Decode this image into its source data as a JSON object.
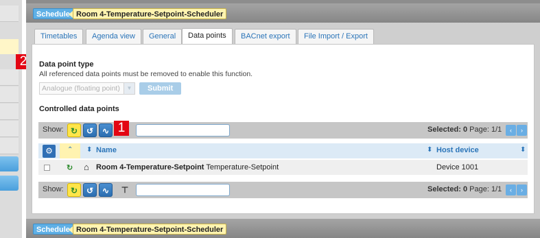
{
  "header": {
    "schedule_tag": "Schedule",
    "object_name": "Room 4-Temperature-Setpoint-Scheduler"
  },
  "tabs": [
    {
      "label": "Timetables",
      "active": false
    },
    {
      "label": "Agenda view",
      "active": false
    },
    {
      "label": "General",
      "active": false
    },
    {
      "label": "Data points",
      "active": true
    },
    {
      "label": "BACnet export",
      "active": false
    },
    {
      "label": "File Import / Export",
      "active": false
    }
  ],
  "data_point_type": {
    "title": "Data point type",
    "note": "All referenced data points must be removed to enable this function.",
    "select_value": "Analogue (floating point)",
    "submit_label": "Submit"
  },
  "controlled": {
    "title": "Controlled data points",
    "show_label": "Show:",
    "selected_label": "Selected:",
    "selected_count": "0",
    "page_label": "Page: 1/1",
    "prev_icon": "chevron-left-icon",
    "next_icon": "chevron-right-icon"
  },
  "table": {
    "columns": {
      "name": "Name",
      "host_device": "Host device"
    },
    "rows": [
      {
        "name": "Room 4-Temperature-Setpoint",
        "description": "Temperature-Setpoint",
        "host_device": "Device 1001"
      }
    ]
  },
  "callouts": {
    "one": "1",
    "two": "2"
  },
  "colors": {
    "accent": "#2a74b8",
    "callout": "#e30613",
    "header_bg": "#8d8d8d"
  }
}
